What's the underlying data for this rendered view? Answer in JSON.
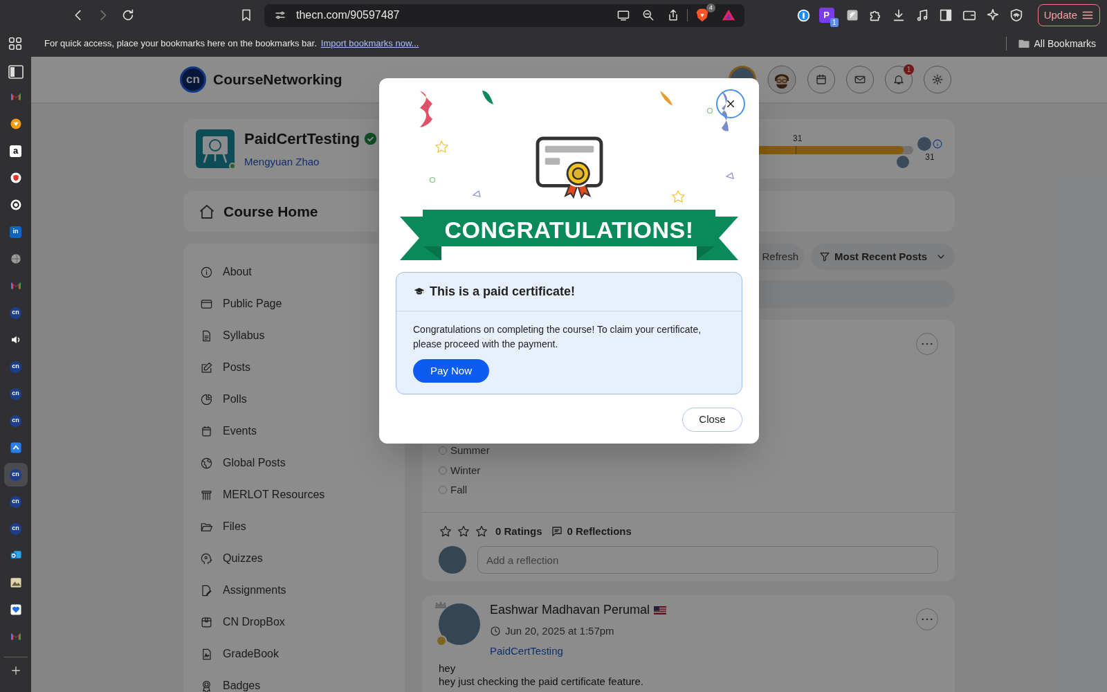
{
  "browser": {
    "url": "thecn.com/90597487",
    "brave_badge": "4",
    "extension_letter": "P",
    "extension_badge": "1",
    "update_button": "Update",
    "bookmarks_hint": "For quick access, place your bookmarks here on the bookmarks bar.",
    "import_link": "Import bookmarks now...",
    "all_bookmarks": "All Bookmarks",
    "sidebar_apps": [
      {
        "kind": "gmail",
        "selected": false
      },
      {
        "kind": "fox",
        "selected": false
      },
      {
        "kind": "amazon",
        "label": "a",
        "selected": false
      },
      {
        "kind": "shield",
        "selected": false
      },
      {
        "kind": "openai",
        "selected": false
      },
      {
        "kind": "linkedin",
        "label": "in",
        "selected": false
      },
      {
        "kind": "globe",
        "selected": false
      },
      {
        "kind": "gmail",
        "selected": false
      },
      {
        "kind": "cn",
        "label": "cn",
        "selected": false
      },
      {
        "kind": "speaker",
        "selected": false
      },
      {
        "kind": "cn",
        "label": "cn",
        "selected": false
      },
      {
        "kind": "cn",
        "label": "cn",
        "selected": false
      },
      {
        "kind": "cn",
        "label": "cn",
        "selected": false
      },
      {
        "kind": "app",
        "selected": false
      },
      {
        "kind": "cn",
        "label": "cn",
        "selected": true
      },
      {
        "kind": "cn",
        "label": "cn",
        "selected": false
      },
      {
        "kind": "cn",
        "label": "cn",
        "selected": false
      },
      {
        "kind": "outlook",
        "selected": false
      },
      {
        "kind": "image",
        "selected": false
      },
      {
        "kind": "heart",
        "selected": false
      },
      {
        "kind": "gmail",
        "selected": false
      }
    ]
  },
  "header": {
    "logo_mark": "cn",
    "site_name": "CourseNetworking",
    "notification_count": "1"
  },
  "course": {
    "name": "PaidCertTesting",
    "verified": true,
    "instructor": "Mengyuan Zhao",
    "progress": {
      "level": 0.96,
      "marker": "31",
      "count": "31"
    }
  },
  "course_home": {
    "title": "Course Home"
  },
  "course_menu": [
    {
      "kind": "about",
      "label": "About"
    },
    {
      "kind": "page",
      "label": "Public Page"
    },
    {
      "kind": "syllabus",
      "label": "Syllabus"
    },
    {
      "kind": "posts",
      "label": "Posts"
    },
    {
      "kind": "polls",
      "label": "Polls"
    },
    {
      "kind": "events",
      "label": "Events"
    },
    {
      "kind": "global",
      "label": "Global Posts"
    },
    {
      "kind": "resources",
      "label": "MERLOT Resources"
    },
    {
      "kind": "files",
      "label": "Files"
    },
    {
      "kind": "quizzes",
      "label": "Quizzes"
    },
    {
      "kind": "assignments",
      "label": "Assignments"
    },
    {
      "kind": "dropbox",
      "label": "CN DropBox"
    },
    {
      "kind": "gradebook",
      "label": "GradeBook"
    },
    {
      "kind": "badges",
      "label": "Badges"
    }
  ],
  "feed": {
    "refresh": "Refresh",
    "sort": "Most Recent Posts"
  },
  "poll_post": {
    "options": [
      {
        "label": "Summer",
        "selected": false
      },
      {
        "label": "Winter",
        "selected": false
      },
      {
        "label": "Fall",
        "selected": false
      }
    ],
    "stars": 0,
    "ratings": "0 Ratings",
    "reflections": "0 Reflections",
    "reflection_placeholder": "Add a reflection"
  },
  "text_post": {
    "author": "Eashwar Madhavan Perumal",
    "time": "Jun 20, 2025 at 1:57pm",
    "course_link": "PaidCertTesting",
    "lines": [
      "hey",
      "hey just checking the paid certificate feature."
    ]
  },
  "modal": {
    "banner": "CONGRATULATIONS!",
    "notice_title": "This is a paid certificate!",
    "message": "Congratulations on completing the course! To claim your certificate, please proceed with the payment.",
    "pay_button": "Pay Now",
    "close_button": "Close"
  }
}
